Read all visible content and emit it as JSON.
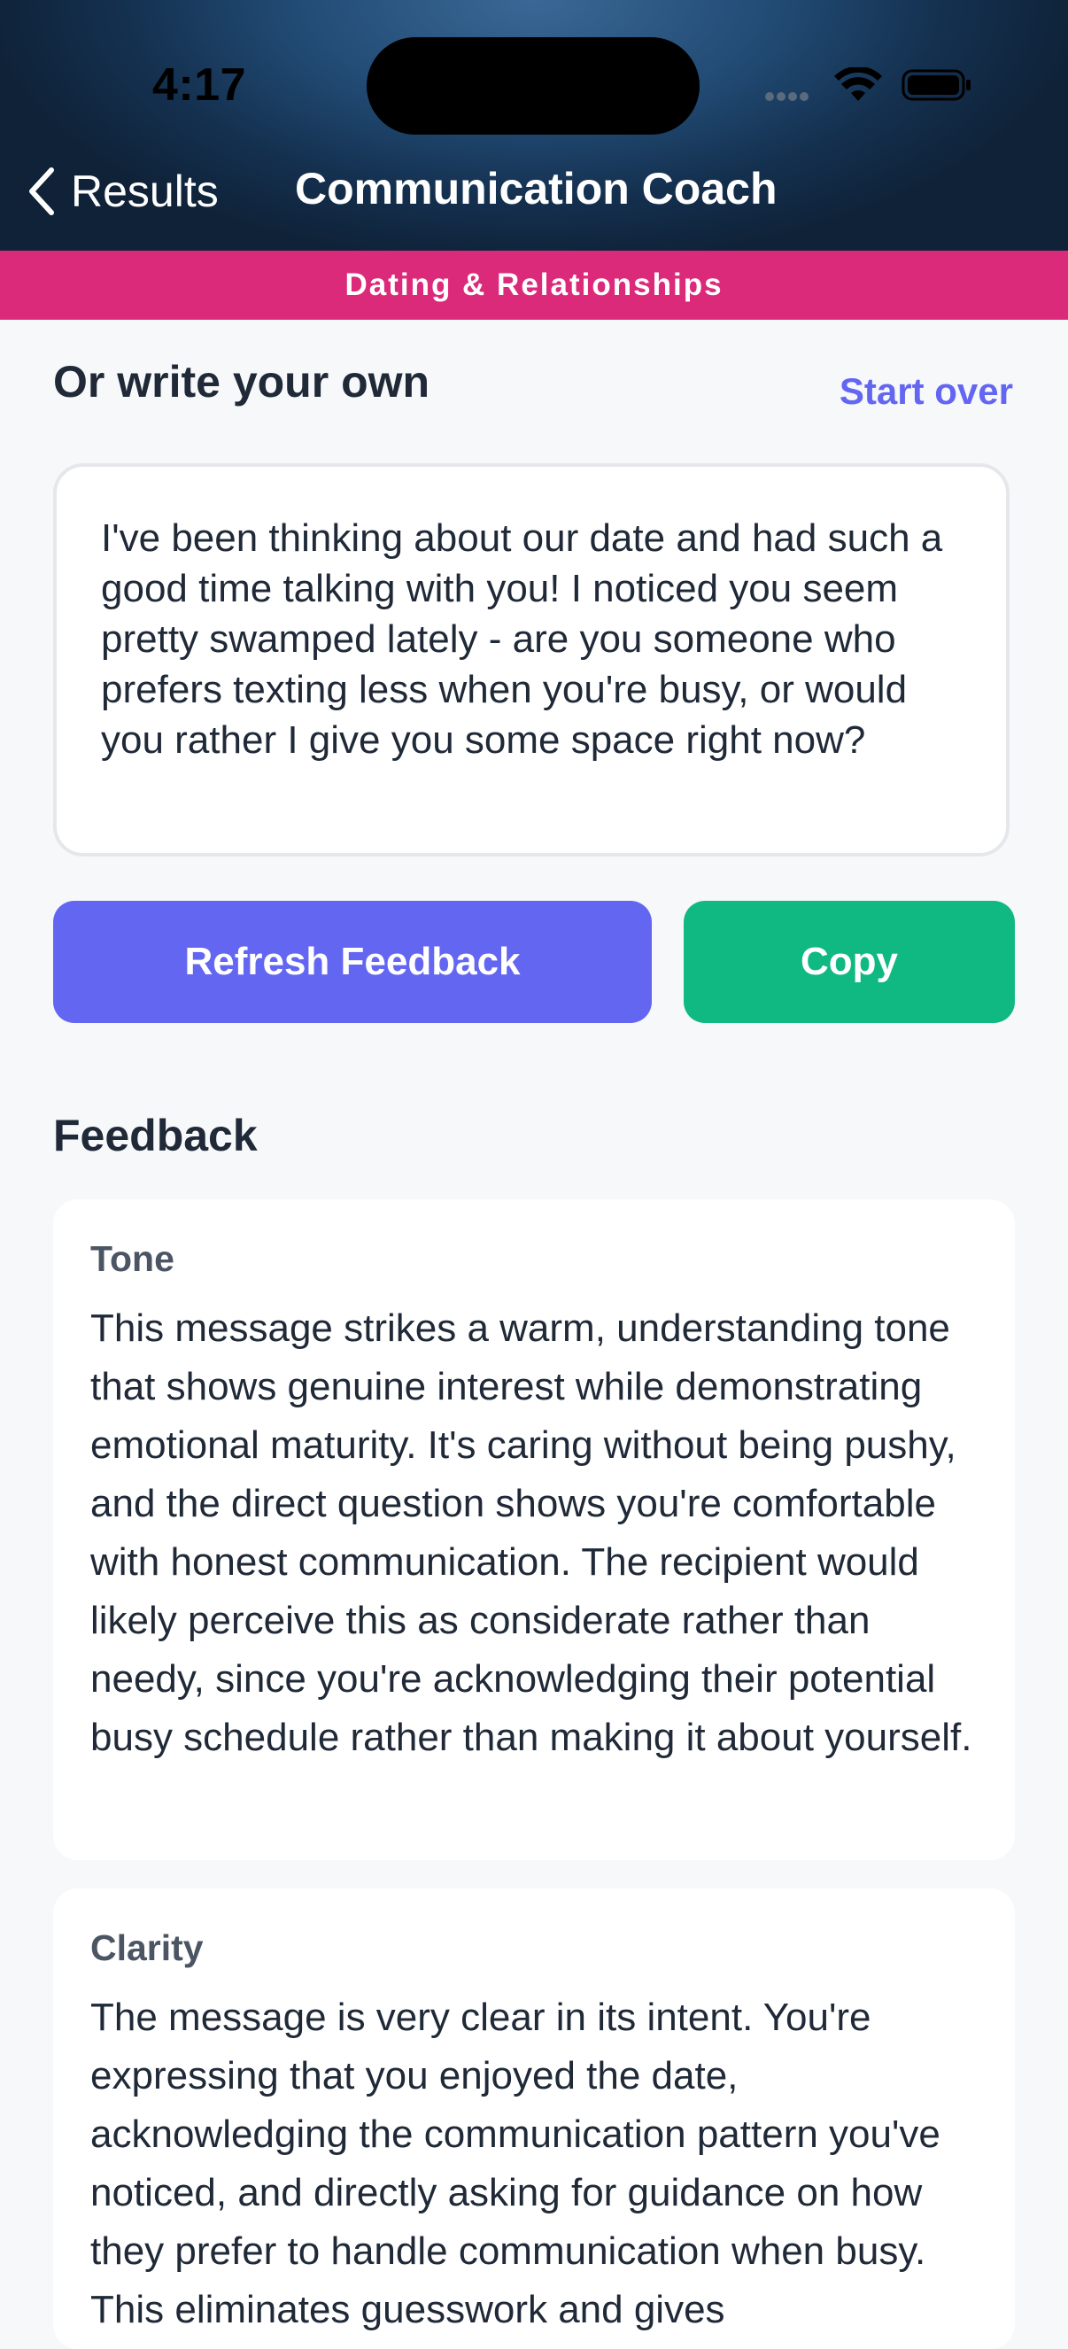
{
  "status_bar": {
    "time": "4:17"
  },
  "nav": {
    "back_label": "Results",
    "title": "Communication Coach"
  },
  "category": "Dating & Relationships",
  "compose": {
    "heading": "Or write your own",
    "start_over": "Start over",
    "message": "I've been thinking about our date and had such a good time talking with you! I noticed you seem pretty swamped lately - are you someone who prefers texting less when you're busy, or would you rather I give you some space right now?"
  },
  "actions": {
    "refresh_label": "Refresh Feedback",
    "copy_label": "Copy"
  },
  "feedback": {
    "heading": "Feedback",
    "cards": [
      {
        "label": "Tone",
        "text": "This message strikes a warm, understanding tone that shows genuine interest while demonstrating emotional maturity. It's caring without being pushy, and the direct question shows you're comfortable with honest communication. The recipient would likely perceive this as considerate rather than needy, since you're acknowledging their potential busy schedule rather than making it about yourself."
      },
      {
        "label": "Clarity",
        "text": "The message is very clear in its intent. You're expressing that you enjoyed the date, acknowledging the communication pattern you've noticed, and directly asking for guidance on how they prefer to handle communication when busy. This eliminates guesswork and gives"
      }
    ]
  },
  "colors": {
    "accent": "#6366f1",
    "copy_button": "#10b981",
    "category_banner": "#dc2a7b"
  }
}
